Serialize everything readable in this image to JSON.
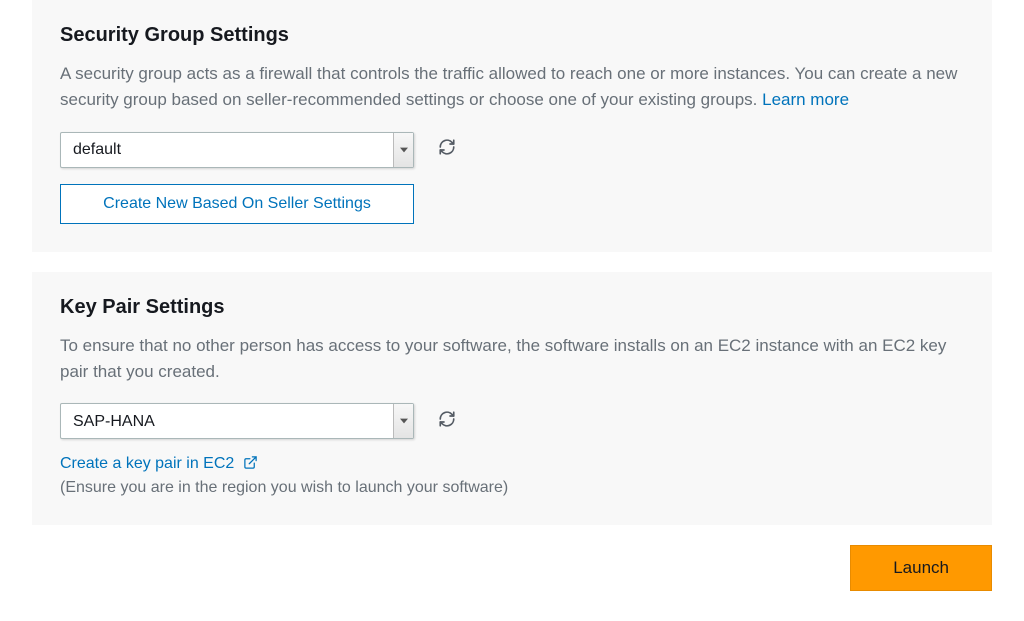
{
  "securityGroup": {
    "title": "Security Group Settings",
    "description_prefix": "A security group acts as a firewall that controls the traffic allowed to reach one or more instances. You can create a new security group based on seller-recommended settings or choose one of your existing groups. ",
    "learn_more_label": "Learn more",
    "selected": "default",
    "create_button_label": "Create New Based On Seller Settings"
  },
  "keyPair": {
    "title": "Key Pair Settings",
    "description": "To ensure that no other person has access to your software, the software installs on an EC2 instance with an EC2 key pair that you created.",
    "selected": "SAP-HANA",
    "create_link_label": "Create a key pair in EC2",
    "region_note": "(Ensure you are in the region you wish to launch your software)"
  },
  "footer": {
    "launch_label": "Launch"
  }
}
